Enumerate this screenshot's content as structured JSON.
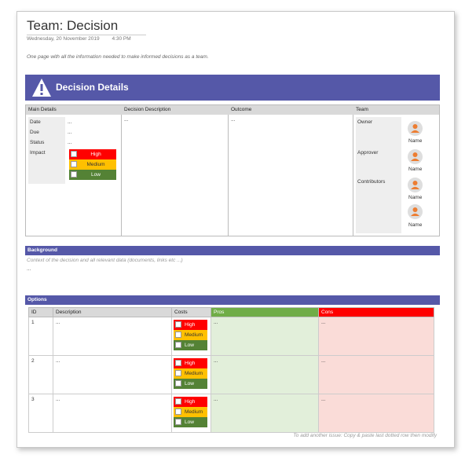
{
  "header": {
    "title": "Team: Decision",
    "date": "Wednesday, 20 November 2019",
    "time": "4:30 PM",
    "subtitle": "One page with all the information needed to make informed decisions as a team."
  },
  "banner": {
    "title": "Decision Details",
    "icon": "warning-icon",
    "color": "#5558a8"
  },
  "details": {
    "headers": {
      "main": "Main Details",
      "description": "Decision Description",
      "outcome": "Outcome",
      "team": "Team"
    },
    "main": {
      "date_label": "Date",
      "date_value": "...",
      "due_label": "Due",
      "due_value": "...",
      "status_label": "Status",
      "status_value": "...",
      "impact_label": "Impact",
      "impact_options": {
        "high": "High",
        "medium": "Medium",
        "low": "Low"
      }
    },
    "description_value": "...",
    "outcome_value": "...",
    "team": {
      "owner_label": "Owner",
      "owner_name": "Name",
      "approver_label": "Approver",
      "approver_name": "Name",
      "contributors_label": "Contributors",
      "contributor1_name": "Name",
      "contributor2_name": "Name"
    }
  },
  "background": {
    "title": "Background",
    "placeholder": "Context of the decision and all relevant data (documents, links etc ...)",
    "value": "..."
  },
  "options": {
    "title": "Options",
    "columns": {
      "id": "ID",
      "description": "Description",
      "costs": "Costs",
      "pros": "Pros",
      "cons": "Cons"
    },
    "cost_levels": {
      "high": "High",
      "medium": "Medium",
      "low": "Low"
    },
    "rows": [
      {
        "id": "1",
        "description": "...",
        "pros": "...",
        "cons": "..."
      },
      {
        "id": "2",
        "description": "...",
        "pros": "...",
        "cons": "..."
      },
      {
        "id": "3",
        "description": "...",
        "pros": "...",
        "cons": "..."
      }
    ]
  },
  "footnote": "To add another issue: Copy & paste last dotted row then modify",
  "colors": {
    "accent": "#5558a8",
    "high": "#ff0000",
    "medium": "#ffc000",
    "low": "#548235",
    "pros": "#70ad47",
    "cons": "#ff0000",
    "avatar": "#ed7d31"
  }
}
